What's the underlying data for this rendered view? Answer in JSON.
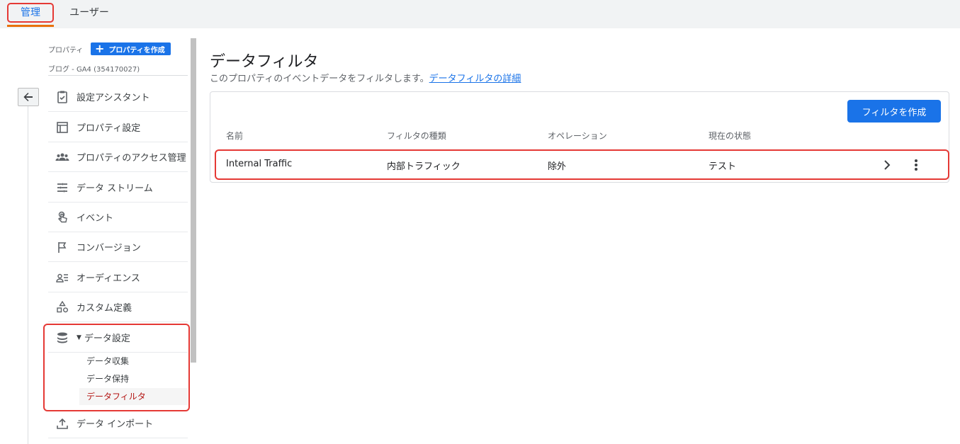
{
  "tabs": [
    {
      "label": "管理",
      "active": true
    },
    {
      "label": "ユーザー",
      "active": false
    }
  ],
  "sidebar": {
    "property_label": "プロパティ",
    "create_property_label": "プロパティを作成",
    "account_name": "ブログ - GA4 (354170027)",
    "items": [
      {
        "label": "設定アシスタント",
        "icon": "clipboard-check-icon"
      },
      {
        "label": "プロパティ設定",
        "icon": "layout-icon"
      },
      {
        "label": "プロパティのアクセス管理",
        "icon": "people-icon"
      },
      {
        "label": "データ ストリーム",
        "icon": "streams-icon"
      },
      {
        "label": "イベント",
        "icon": "touch-icon"
      },
      {
        "label": "コンバージョン",
        "icon": "flag-icon"
      },
      {
        "label": "オーディエンス",
        "icon": "audience-icon"
      },
      {
        "label": "カスタム定義",
        "icon": "shapes-icon"
      },
      {
        "label": "データ設定",
        "icon": "database-icon",
        "expanded": true
      },
      {
        "label": "データ インポート",
        "icon": "upload-icon"
      }
    ],
    "sub_items": [
      {
        "label": "データ収集",
        "active": false
      },
      {
        "label": "データ保持",
        "active": false
      },
      {
        "label": "データフィルタ",
        "active": true
      }
    ]
  },
  "main": {
    "title": "データフィルタ",
    "description": "このプロパティのイベントデータをフィルタします。",
    "description_link": "データフィルタの詳細",
    "create_button": "フィルタを作成",
    "columns": [
      "名前",
      "フィルタの種類",
      "オペレーション",
      "現在の状態"
    ],
    "rows": [
      {
        "name": "Internal Traffic",
        "type": "内部トラフィック",
        "operation": "除外",
        "state": "テスト"
      }
    ]
  },
  "colors": {
    "accent": "#1a73e8",
    "highlight": "#e53935",
    "active_sub": "#b31412"
  }
}
